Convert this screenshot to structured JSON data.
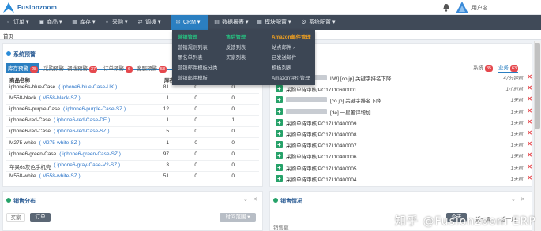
{
  "header": {
    "brand": "Fusionzoom",
    "user_label": "用户名"
  },
  "nav": [
    {
      "label": "订单",
      "icon": "cart-icon"
    },
    {
      "label": "商品",
      "icon": "box-icon"
    },
    {
      "label": "库存",
      "icon": "store-icon"
    },
    {
      "label": "采购",
      "icon": "truck-icon"
    },
    {
      "label": "调拨",
      "icon": "transfer-icon"
    },
    {
      "label": "CRM",
      "icon": "mail-icon"
    },
    {
      "label": "数据报表",
      "icon": "chart-icon"
    },
    {
      "label": "模块配置",
      "icon": "grid-icon"
    },
    {
      "label": "系统配置",
      "icon": "gear-icon"
    }
  ],
  "tabbar": {
    "home": "首页"
  },
  "crm_menu": {
    "col1": {
      "head": "营销管理",
      "items": [
        "营销规则列表",
        "黑名单列表",
        "营销邮件模板分类",
        "营销邮件模板"
      ]
    },
    "col2": {
      "head": "售后管理",
      "items": [
        "反馈列表",
        "买家列表"
      ]
    },
    "col3": {
      "head": "Amazon邮件管理",
      "items": [
        "站点邮件",
        "已发送邮件",
        "模板列表",
        "Amazon评价管理"
      ]
    }
  },
  "warning_panel": {
    "title": "系统预警",
    "tabs": [
      {
        "label": "库存预警",
        "count": "28"
      },
      {
        "label": "采购预警",
        "count": "0"
      },
      {
        "label": "调拨预警",
        "count": "37"
      },
      {
        "label": "订单预警",
        "count": "6"
      },
      {
        "label": "客服预警",
        "count": "53"
      }
    ],
    "columns": [
      "商品名称",
      "库存"
    ],
    "rows": [
      {
        "name": "iphone6s-blue-Case",
        "sku": "iphone6-blue-Case-UK",
        "v1": "81",
        "v2": "0",
        "v3": "0"
      },
      {
        "name": "M558-black",
        "sku": "M558-black-SZ",
        "v1": "1",
        "v2": "0",
        "v3": "0"
      },
      {
        "name": "iphone6s-purple-Case",
        "sku": "iphone6-purple-Case-SZ",
        "v1": "12",
        "v2": "0",
        "v3": "0"
      },
      {
        "name": "iphone6-red-Case",
        "sku": "iphone6-red-Case-DE",
        "v1": "1",
        "v2": "0",
        "v3": "1"
      },
      {
        "name": "iphone6-red-Case",
        "sku": "iphone6-red-Case-SZ",
        "v1": "5",
        "v2": "0",
        "v3": "0"
      },
      {
        "name": "M275-white",
        "sku": "M275-white-SZ",
        "v1": "1",
        "v2": "0",
        "v3": "0"
      },
      {
        "name": "iphone6-green-Case",
        "sku": "iphone6-green-Case-SZ",
        "v1": "97",
        "v2": "0",
        "v3": "0"
      },
      {
        "name": "苹果6s灰色手机壳",
        "sku": "iphone6-gray-Case-V2-SZ",
        "v1": "3",
        "v2": "0",
        "v3": "0"
      },
      {
        "name": "M558-white",
        "sku": "M558-white-SZ",
        "v1": "51",
        "v2": "0",
        "v3": "0"
      }
    ]
  },
  "msg_panel": {
    "tabs": [
      {
        "label": "系统",
        "count": "35"
      },
      {
        "label": "业务",
        "count": "63"
      }
    ],
    "rows": [
      {
        "text": "LW]  [co.jp]  关键字排名下降",
        "time": "47分钟前"
      },
      {
        "text": "采购单待审核:PO17110600001",
        "time": "1小时前"
      },
      {
        "text": "[co.jp]  关键字排名下降",
        "time": "1天前"
      },
      {
        "text": "[de]  一星差评增加",
        "time": "1天前"
      },
      {
        "text": "采购单待审核:PO17110400009",
        "time": "1天前"
      },
      {
        "text": "采购单待审核:PO17110400008",
        "time": "1天前"
      },
      {
        "text": "采购单待审核:PO17110400007",
        "time": "1天前"
      },
      {
        "text": "采购单待审核:PO17110400006",
        "time": "1天前"
      },
      {
        "text": "采购单待审核:PO17110400005",
        "time": "1天前"
      },
      {
        "text": "采购单待审核:PO17110400004",
        "time": "1天前"
      }
    ]
  },
  "sales_dist": {
    "title": "销售分布",
    "tabs": [
      "买家",
      "订单"
    ],
    "time_btn": "时间范围"
  },
  "sales_status": {
    "title": "销售情况",
    "btns": [
      "今天",
      "近一周",
      "近一月"
    ],
    "sub": "销售额"
  },
  "watermark": "知乎 @Fusionzoom ERP",
  "colors": {
    "nav_bg": "#404a58",
    "accent": "#2b7fc1",
    "badge": "#e5484d",
    "plus": "#26a269"
  }
}
